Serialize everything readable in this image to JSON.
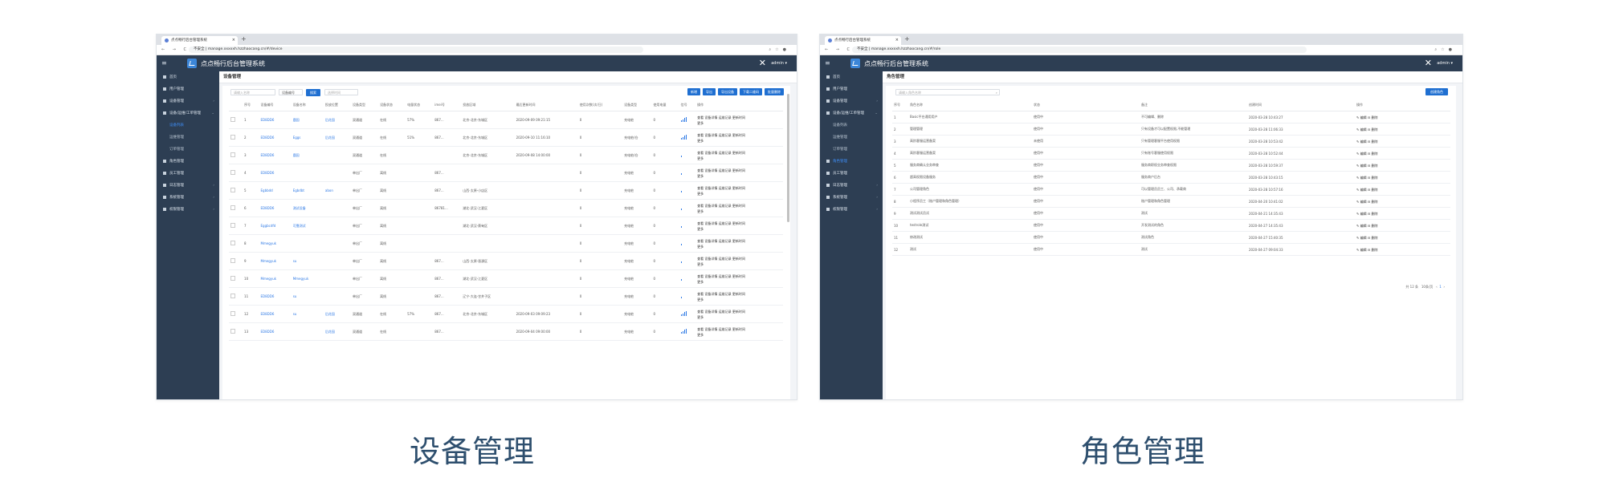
{
  "captions": {
    "left": "设备管理",
    "right": "角色管理"
  },
  "left": {
    "tab_title": "点点畅行后台管理系统",
    "url_prefix": "不安全",
    "url": "manage.xxxxxh.hzzhaocang.cn/#/device",
    "app_title": "点点畅行后台管理系统",
    "user": "admin ▾",
    "sidebar": [
      {
        "label": "首页",
        "sub": false
      },
      {
        "label": "用户管理",
        "sub": false
      },
      {
        "label": "设备管理",
        "sub": false,
        "arrow": "›"
      },
      {
        "label": "设备/运维/工单管理",
        "sub": false,
        "arrow": "⌄"
      },
      {
        "label": "设备列表",
        "sub": true,
        "active": true
      },
      {
        "label": "运维管理",
        "sub": true
      },
      {
        "label": "订单管理",
        "sub": true
      },
      {
        "label": "角色管理",
        "sub": false
      },
      {
        "label": "员工管理",
        "sub": false
      },
      {
        "label": "日志管理",
        "sub": false,
        "arrow": "›"
      },
      {
        "label": "系统管理",
        "sub": false,
        "arrow": "›"
      },
      {
        "label": "权限管理",
        "sub": false,
        "arrow": "›"
      }
    ],
    "page_title": "设备管理",
    "filter_placeholder_1": "请输入名称",
    "filter_select": "设备编号",
    "search_btn": "搜索",
    "filter_placeholder_2": "选择时间",
    "action_buttons": [
      "新增",
      "导出",
      "导出设备",
      "下载二维码",
      "批量删除"
    ],
    "columns": [
      "",
      "序号",
      "设备编号",
      "设备名称",
      "投放位置",
      "设备类型",
      "设备状态",
      "电量状态",
      "imei号",
      "投放区域",
      "最后更新时间",
      "使用次数(次/日)",
      "设备类型",
      "使用电量",
      "信号",
      "操作"
    ],
    "rows": [
      {
        "no": "1",
        "code": "ED8DD6",
        "name": "鹿园",
        "place": "后花园",
        "type": "双通道",
        "status": "在线",
        "power": "57%",
        "imei": "867...",
        "area": "北京-北京-东城区",
        "time": "2020-09-09 09:21:15",
        "uses": "0",
        "kind": "充电桩",
        "batt": "0",
        "sig": 4
      },
      {
        "no": "2",
        "code": "ED8DD6",
        "name": "Eggs",
        "place": "后花园",
        "type": "双通道",
        "status": "在线",
        "power": "51%",
        "imei": "867...",
        "area": "北京-北京-东城区",
        "time": "2020-09-10 11:16:10",
        "uses": "0",
        "kind": "充电桩/仓",
        "batt": "0",
        "sig": 4
      },
      {
        "no": "3",
        "code": "ED8DD6",
        "name": "鹿园",
        "place": "",
        "type": "双通道",
        "status": "在线",
        "power": "",
        "imei": "",
        "area": "北京-北京-东城区",
        "time": "2020-09-08 14:00:00",
        "uses": "0",
        "kind": "充电桩/仓",
        "batt": "0",
        "sig": 1
      },
      {
        "no": "4",
        "code": "ED8DD6",
        "name": "",
        "place": "",
        "type": "单出厂",
        "status": "离线",
        "power": "",
        "imei": "867...",
        "area": "",
        "time": "",
        "uses": "0",
        "kind": "充电桩",
        "batt": "0",
        "sig": 1
      },
      {
        "no": "5",
        "code": "Egbbdd",
        "name": "Egbdbt",
        "place": "abon",
        "type": "单出厂",
        "status": "离线",
        "power": "",
        "imei": "867...",
        "area": "山西-太原-小店区",
        "time": "",
        "uses": "0",
        "kind": "充电桩",
        "batt": "0",
        "sig": 1
      },
      {
        "no": "6",
        "code": "ED8DD6",
        "name": "测试设备",
        "place": "",
        "type": "单出厂",
        "status": "离线",
        "power": "",
        "imei": "86781...",
        "area": "湖北-武汉-江夏区",
        "time": "",
        "uses": "0",
        "kind": "充电桩",
        "batt": "0",
        "sig": 1
      },
      {
        "no": "7",
        "code": "Eggbcdfd",
        "name": "可靠测试",
        "place": "",
        "type": "单出厂",
        "status": "离线",
        "power": "",
        "imei": "",
        "area": "湖北-武汉-蔡甸区",
        "time": "",
        "uses": "0",
        "kind": "充电桩",
        "batt": "0",
        "sig": 1
      },
      {
        "no": "8",
        "code": "Mmegyuk",
        "name": "",
        "place": "",
        "type": "单出厂",
        "status": "离线",
        "power": "",
        "imei": "",
        "area": "",
        "time": "",
        "uses": "0",
        "kind": "充电桩",
        "batt": "0",
        "sig": 1
      },
      {
        "no": "9",
        "code": "Mmegyuk",
        "name": "su",
        "place": "",
        "type": "单出厂",
        "status": "离线",
        "power": "",
        "imei": "867...",
        "area": "山西-太原-晋源区",
        "time": "",
        "uses": "0",
        "kind": "充电桩",
        "batt": "0",
        "sig": 1
      },
      {
        "no": "10",
        "code": "Mmegyuk",
        "name": "Mmegyuk",
        "place": "",
        "type": "单出厂",
        "status": "离线",
        "power": "",
        "imei": "867...",
        "area": "湖北-武汉-江夏区",
        "time": "",
        "uses": "0",
        "kind": "充电桩",
        "batt": "0",
        "sig": 1
      },
      {
        "no": "11",
        "code": "ED8DD6",
        "name": "su",
        "place": "",
        "type": "单出厂",
        "status": "离线",
        "power": "",
        "imei": "867...",
        "area": "辽宁-大连-甘井子区",
        "time": "",
        "uses": "0",
        "kind": "充电桩",
        "batt": "0",
        "sig": 1
      },
      {
        "no": "12",
        "code": "ED8DD6",
        "name": "su",
        "place": "后花园",
        "type": "双通道",
        "status": "在线",
        "power": "57%",
        "imei": "867...",
        "area": "北京-北京-东城区",
        "time": "2020-09-03 09:09:23",
        "uses": "0",
        "kind": "充电桩",
        "batt": "0",
        "sig": 4
      },
      {
        "no": "13",
        "code": "ED8DD6",
        "name": "",
        "place": "后花园",
        "type": "双通道",
        "status": "在线",
        "power": "",
        "imei": "867...",
        "area": "",
        "time": "2020-09-04 09:00:00",
        "uses": "0",
        "kind": "充电桩",
        "batt": "0",
        "sig": 4
      }
    ],
    "ops": "查看  设备详情  运维记录  更新时间",
    "ops2": "更多"
  },
  "right": {
    "tab_title": "点点畅行后台管理系统",
    "url_prefix": "不安全",
    "url": "manage.xxxxxh.hzzhaocang.cn/#/role",
    "app_title": "点点畅行后台管理系统",
    "user": "admin ▾",
    "sidebar": [
      {
        "label": "首页",
        "sub": false
      },
      {
        "label": "用户管理",
        "sub": false
      },
      {
        "label": "设备管理",
        "sub": false,
        "arrow": "›"
      },
      {
        "label": "设备/运维/工单管理",
        "sub": false,
        "arrow": "⌄"
      },
      {
        "label": "设备列表",
        "sub": true
      },
      {
        "label": "运维管理",
        "sub": true
      },
      {
        "label": "订单管理",
        "sub": true
      },
      {
        "label": "角色管理",
        "sub": false,
        "active": true
      },
      {
        "label": "员工管理",
        "sub": false
      },
      {
        "label": "日志管理",
        "sub": false,
        "arrow": "›"
      },
      {
        "label": "系统管理",
        "sub": false,
        "arrow": "›"
      },
      {
        "label": "权限管理",
        "sub": false,
        "arrow": "›"
      }
    ],
    "page_title": "角色管理",
    "search_placeholder": "请输入角色名称",
    "add_btn": "创建角色",
    "columns": [
      "序号",
      "角色名称",
      "状态",
      "备注",
      "创建时间",
      "操作"
    ],
    "rows": [
      {
        "no": "1",
        "name": "Basic平台通用用户",
        "status": "使用中",
        "note": "不可编辑、删除",
        "time": "2020-03-28 10:43:27"
      },
      {
        "no": "2",
        "name": "管理管理",
        "status": "使用中",
        "note": "只有设备才可以配置权限,不能管理",
        "time": "2020-03-28 11:06:33"
      },
      {
        "no": "3",
        "name": "高阶客服运营备案",
        "status": "未使用",
        "note": "只有管理客服平台使用权限",
        "time": "2020-03-28 10:53:42"
      },
      {
        "no": "4",
        "name": "高阶客服运营备案",
        "status": "使用中",
        "note": "只有账号客服使用权限",
        "time": "2020-03-28 10:52:44"
      },
      {
        "no": "5",
        "name": "服务商确认业务审查",
        "status": "使用中",
        "note": "服务商职权业务审查权限",
        "time": "2020-03-28 10:59:37"
      },
      {
        "no": "6",
        "name": "超高权限设备服务",
        "status": "使用中",
        "note": "服务商户后台",
        "time": "2020-03-28 10:43:15"
      },
      {
        "no": "7",
        "name": "公司管理角色",
        "status": "使用中",
        "note": "可以管理员员工、公司、承载商",
        "time": "2020-03-28 10:57:16"
      },
      {
        "no": "8",
        "name": "小程序员工（账户管理和角色管理）",
        "status": "使用中",
        "note": "账户管理和角色管理",
        "time": "2020-04-20 10:41:02"
      },
      {
        "no": "9",
        "name": "测试测试员试",
        "status": "使用中",
        "note": "测试",
        "time": "2020-04-21 14:35:43"
      },
      {
        "no": "10",
        "name": "testrole测试",
        "status": "使用中",
        "note": "开发测试的角色",
        "time": "2020-04-27 14:35:43"
      },
      {
        "no": "11",
        "name": "修改测试",
        "status": "使用中",
        "note": "测试角色",
        "time": "2020-04-27 15:40:35"
      },
      {
        "no": "12",
        "name": "测试",
        "status": "使用中",
        "note": "测试",
        "time": "2020-04-27 09:04:33"
      }
    ],
    "ops": "✎ 编辑   ⊟ 删除",
    "pager": {
      "total": "共 12 条",
      "size": "10条/页",
      "page": "1"
    }
  }
}
